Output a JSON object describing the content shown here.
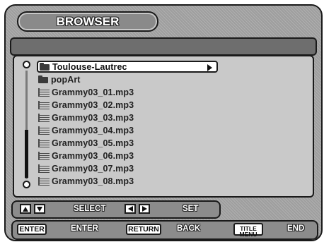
{
  "header": {
    "title": "BROWSER"
  },
  "browser": {
    "items": [
      {
        "label": "Toulouse-Lautrec",
        "icon": "folder-icon",
        "selected": true
      },
      {
        "label": "popArt",
        "icon": "folder-icon"
      },
      {
        "label": "Grammy03_01.mp3",
        "icon": "audio-file-icon"
      },
      {
        "label": "Grammy03_02.mp3",
        "icon": "audio-file-icon"
      },
      {
        "label": "Grammy03_03.mp3",
        "icon": "audio-file-icon"
      },
      {
        "label": "Grammy03_04.mp3",
        "icon": "audio-file-icon"
      },
      {
        "label": "Grammy03_05.mp3",
        "icon": "audio-file-icon"
      },
      {
        "label": "Grammy03_06.mp3",
        "icon": "audio-file-icon"
      },
      {
        "label": "Grammy03_07.mp3",
        "icon": "audio-file-icon"
      },
      {
        "label": "Grammy03_08.mp3",
        "icon": "audio-file-icon"
      }
    ]
  },
  "footer": {
    "select_label": "SELECT",
    "set_label": "SET",
    "enter_key": "ENTER",
    "enter_label": "ENTER",
    "return_key": "RETURN",
    "back_label": "BACK",
    "title_key_line1": "TITLE",
    "title_key_line2": "MENU",
    "end_label": "END"
  }
}
